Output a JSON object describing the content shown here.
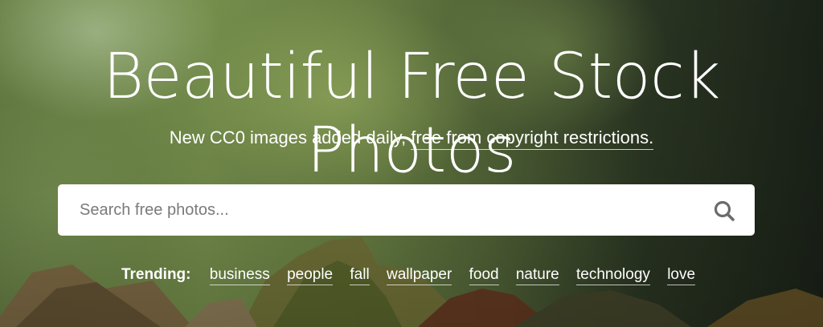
{
  "hero": {
    "title": "Beautiful Free Stock Photos",
    "subtitle_prefix": "New CC0 images added daily,",
    "subtitle_link": "free from copyright restrictions.",
    "search_icon": "search-icon"
  },
  "search": {
    "placeholder": "Search free photos...",
    "value": ""
  },
  "trending": {
    "label": "Trending:",
    "items": [
      "business",
      "people",
      "fall",
      "wallpaper",
      "food",
      "nature",
      "technology",
      "love"
    ]
  },
  "colors": {
    "text": "#ffffff",
    "search_bg": "#ffffff",
    "placeholder": "#7a7a7a",
    "icon": "#6b6b6b"
  }
}
